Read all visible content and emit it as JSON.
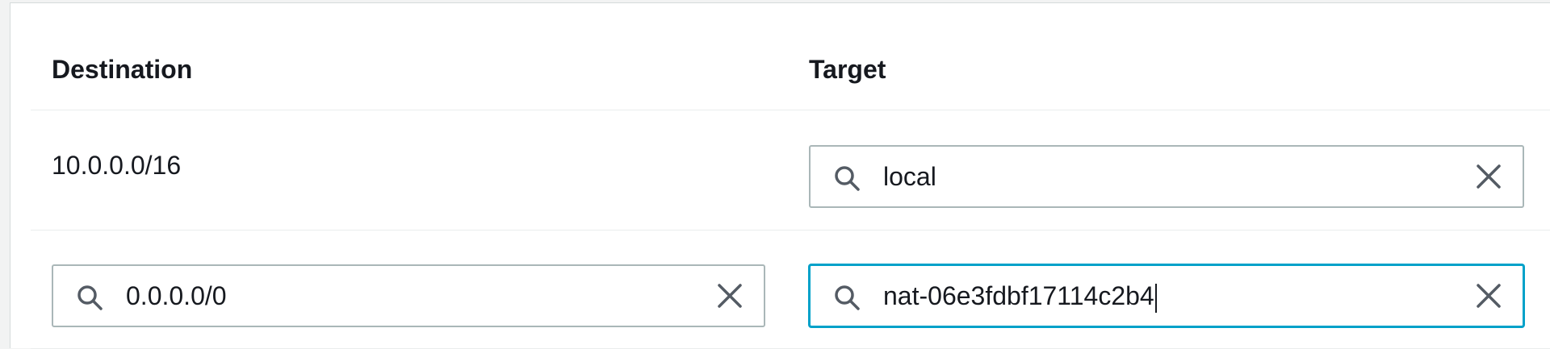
{
  "table": {
    "headers": {
      "destination": "Destination",
      "target": "Target"
    },
    "rows": [
      {
        "destination": "10.0.0.0/16",
        "target": "local"
      },
      {
        "destination": "0.0.0.0/0",
        "target": "nat-06e3fdbf17114c2b4"
      }
    ]
  },
  "icons": {
    "search": "search-icon",
    "clear": "close-icon"
  },
  "colors": {
    "focus_border": "#00a1c9",
    "input_border": "#aab7b8",
    "text": "#16191f",
    "divider": "#eaeded"
  }
}
